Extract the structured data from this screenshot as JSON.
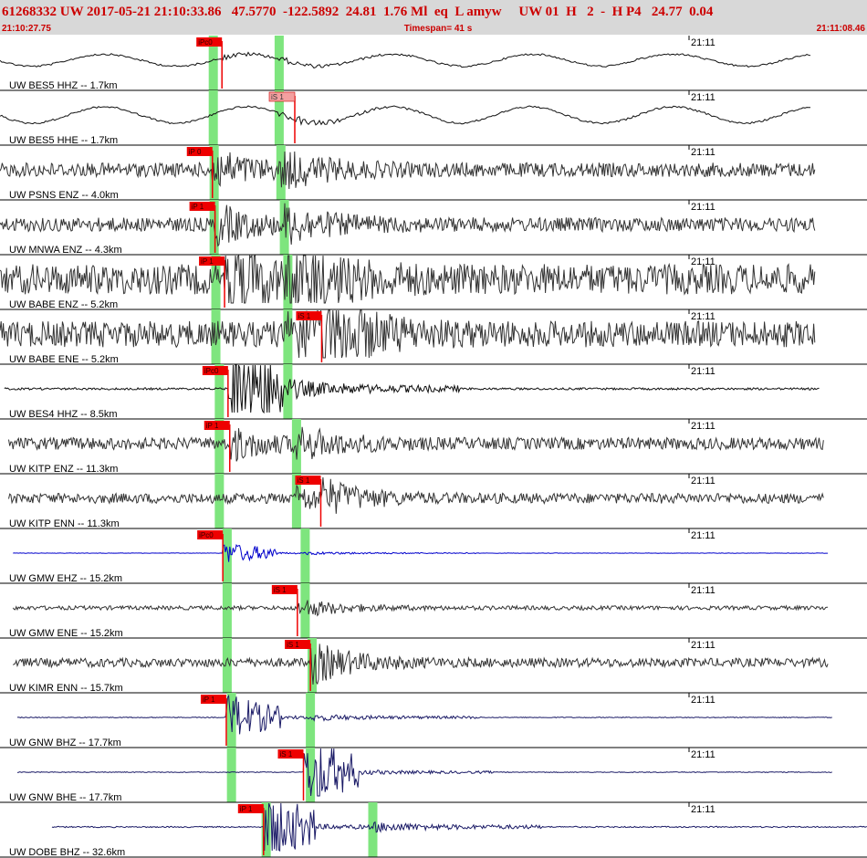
{
  "header": {
    "event_line": "61268332 UW 2017-05-21 21:10:33.86   47.5770  -122.5892  24.81  1.76 Ml  eq  L amyw     UW 01  H   2  -  H P4   24.77  0.04",
    "start_time": "21:10:27.75",
    "timespan": "Timespan=  41 s",
    "end_time": "21:11:08.46"
  },
  "colors": {
    "header_bg": "#d8d8d8",
    "header_text": "#cc0000",
    "phase_window": "#7ee57e",
    "pick_flag": "#ee0000",
    "selected_pick_flag": "#f4a0a0",
    "trace_default": "#333333",
    "trace_selected": "#0000cc",
    "trace_broadband": "#1a1a66"
  },
  "minute_label": "21:11",
  "traces": [
    {
      "label": "UW BES5 HHZ -- 1.7km",
      "pick": "iPc0",
      "pick_pos": 0.256,
      "phase_pos": [
        0.246,
        0.322
      ],
      "start": 0.0,
      "end": 0.935,
      "amp": 0.18,
      "type": "lowfreq",
      "color": "#111111",
      "selected": false
    },
    {
      "label": "UW BES5 HHE -- 1.7km",
      "pick": "iS 1",
      "pick_pos": 0.34,
      "phase_pos": [
        0.246,
        0.322
      ],
      "start": 0.0,
      "end": 0.935,
      "amp": 0.3,
      "type": "lowfreq",
      "color": "#111111",
      "selected": true
    },
    {
      "label": "UW PSNS ENZ -- 4.0km",
      "pick": "iP 0",
      "pick_pos": 0.245,
      "phase_pos": [
        0.247,
        0.324
      ],
      "start": 0.0,
      "end": 0.94,
      "amp": 0.35,
      "type": "noise",
      "color": "#333333",
      "selected": false
    },
    {
      "label": "UW MNWA ENZ -- 4.3km",
      "pick": "iP 1",
      "pick_pos": 0.248,
      "phase_pos": [
        0.247,
        0.328
      ],
      "start": 0.0,
      "end": 0.94,
      "amp": 0.35,
      "type": "noise",
      "color": "#333333",
      "selected": false
    },
    {
      "label": "UW BABE ENZ -- 5.2km",
      "pick": "iP 1",
      "pick_pos": 0.259,
      "phase_pos": [
        0.249,
        0.332
      ],
      "start": 0.0,
      "end": 0.94,
      "amp": 0.75,
      "type": "noise",
      "color": "#333333",
      "selected": false
    },
    {
      "label": "UW BABE ENE -- 5.2km",
      "pick": "iS 1",
      "pick_pos": 0.371,
      "phase_pos": [
        0.249,
        0.332
      ],
      "start": 0.0,
      "end": 0.94,
      "amp": 0.65,
      "type": "noise",
      "color": "#333333",
      "selected": false
    },
    {
      "label": "UW BES4 HHZ -- 8.5km",
      "pick": "iPc0",
      "pick_pos": 0.263,
      "phase_pos": [
        0.253,
        0.332
      ],
      "start": 0.005,
      "end": 0.945,
      "amp": 0.08,
      "type": "quiet",
      "color": "#111111",
      "selected": false
    },
    {
      "label": "UW KITP ENZ -- 11.3km",
      "pick": "iP 1",
      "pick_pos": 0.265,
      "phase_pos": [
        0.253,
        0.342
      ],
      "start": 0.01,
      "end": 0.95,
      "amp": 0.3,
      "type": "noise",
      "color": "#333333",
      "selected": false
    },
    {
      "label": "UW KITP ENN -- 11.3km",
      "pick": "iS 1",
      "pick_pos": 0.37,
      "phase_pos": [
        0.253,
        0.342
      ],
      "start": 0.01,
      "end": 0.95,
      "amp": 0.25,
      "type": "noise",
      "color": "#333333",
      "selected": false
    },
    {
      "label": "UW GMW EHZ -- 15.2km",
      "pick": "iPc0",
      "pick_pos": 0.257,
      "phase_pos": [
        0.262,
        0.352
      ],
      "start": 0.015,
      "end": 0.955,
      "amp": 0.0,
      "type": "quiet",
      "color": "#0000cc",
      "selected": false
    },
    {
      "label": "UW GMW ENE -- 15.2km",
      "pick": "iS 1",
      "pick_pos": 0.343,
      "phase_pos": [
        0.262,
        0.352
      ],
      "start": 0.015,
      "end": 0.955,
      "amp": 0.1,
      "type": "noise",
      "color": "#333333",
      "selected": false
    },
    {
      "label": "UW KIMR ENN -- 15.7km",
      "pick": "iS 1",
      "pick_pos": 0.358,
      "phase_pos": [
        0.262,
        0.36
      ],
      "start": 0.015,
      "end": 0.955,
      "amp": 0.22,
      "type": "noise",
      "color": "#333333",
      "selected": false
    },
    {
      "label": "UW GNW BHZ -- 17.7km",
      "pick": "iP 1",
      "pick_pos": 0.261,
      "phase_pos": [
        0.267,
        0.358
      ],
      "start": 0.02,
      "end": 0.96,
      "amp": 0.02,
      "type": "quiet",
      "color": "#1a1a66",
      "selected": false
    },
    {
      "label": "UW GNW BHE -- 17.7km",
      "pick": "iS 1",
      "pick_pos": 0.35,
      "phase_pos": [
        0.267,
        0.358
      ],
      "start": 0.02,
      "end": 0.96,
      "amp": 0.02,
      "type": "quiet",
      "color": "#1a1a66",
      "selected": false
    },
    {
      "label": "UW DOBE BHZ -- 32.6km",
      "pick": "iP 1",
      "pick_pos": 0.304,
      "phase_pos": [
        0.307,
        0.43
      ],
      "start": 0.06,
      "end": 1.0,
      "amp": 0.04,
      "type": "quiet",
      "color": "#1a1a66",
      "selected": false
    }
  ]
}
